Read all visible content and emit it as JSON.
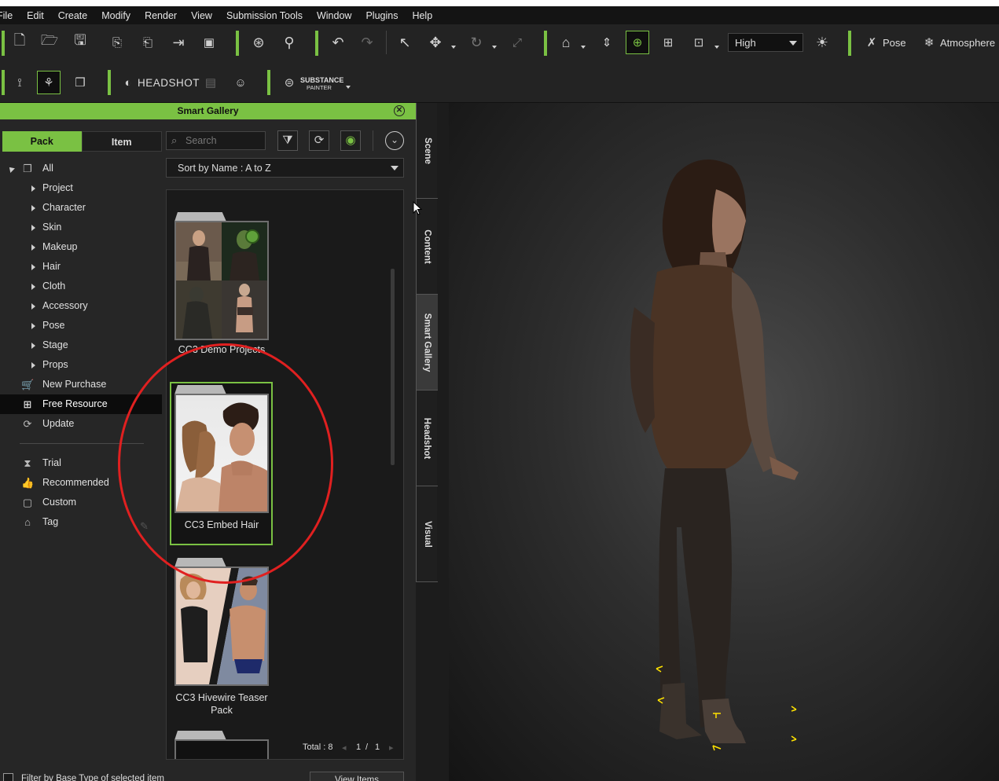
{
  "menu": [
    "File",
    "Edit",
    "Create",
    "Modify",
    "Render",
    "View",
    "Submission Tools",
    "Window",
    "Plugins",
    "Help"
  ],
  "toolbar": {
    "quality": "High",
    "pose_label": "Pose",
    "atmosphere_label": "Atmosphere",
    "headshot_label": "HEADSHOT",
    "substance_label_top": "SUBSTANCE",
    "substance_label_bottom": "PAINTER"
  },
  "gallery": {
    "title": "Smart Gallery",
    "tabs": [
      "Pack",
      "Item"
    ],
    "search_placeholder": "Search",
    "sort_label": "Sort by Name : A to Z",
    "tree": {
      "all": "All",
      "categories": [
        "Project",
        "Character",
        "Skin",
        "Makeup",
        "Hair",
        "Cloth",
        "Accessory",
        "Pose",
        "Stage",
        "Props"
      ],
      "new_purchase": "New Purchase",
      "free_resource": "Free Resource",
      "update": "Update",
      "trial": "Trial",
      "recommended": "Recommended",
      "custom": "Custom",
      "tag": "Tag"
    },
    "packs": [
      {
        "name": "CC3 Demo Projects"
      },
      {
        "name": "CC3 Embed Hair"
      },
      {
        "name": "CC3 Hivewire Teaser Pack"
      }
    ],
    "total": "Total : 8",
    "page": "1",
    "page_sep": "/",
    "pages": "1",
    "filter_label": "Filter by Base Type of selected item",
    "view_items": "View Items"
  },
  "side_tabs": [
    "Scene",
    "Content",
    "Smart Gallery",
    "Headshot",
    "Visual"
  ],
  "colors": {
    "accent": "#7ac143",
    "annotation": "#e02020",
    "panel": "#262626"
  }
}
